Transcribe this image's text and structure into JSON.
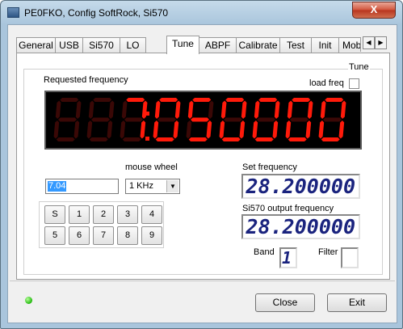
{
  "window": {
    "title": "PE0FKO, Config SoftRock, Si570",
    "close_glyph": "X"
  },
  "tabs": [
    "General",
    "USB",
    "Si570",
    "LO",
    "Tune",
    "ABPF",
    "Calibrate",
    "Test",
    "Init",
    "Mob"
  ],
  "active_tab": "Tune",
  "tab_scroll": {
    "left": "◀",
    "right": "▶"
  },
  "tune": {
    "group_title": "Tune",
    "requested_label": "Requested frequency",
    "load_freq_label": "load freq",
    "load_freq_checked": false,
    "big_display_value": "7.050000",
    "big_display_digits": "7050000",
    "mouse_wheel_label": "mouse wheel",
    "freq_input_value": "7.04",
    "step_value": "1 KHz",
    "keypad": [
      "S",
      "1",
      "2",
      "3",
      "4",
      "5",
      "6",
      "7",
      "8",
      "9"
    ],
    "set_freq_label": "Set frequency",
    "set_freq_value": "28.200000",
    "output_freq_label": "Si570 output frequency",
    "output_freq_value": "28.200000",
    "band_label": "Band",
    "band_value": "1",
    "filter_label": "Filter",
    "filter_value": ""
  },
  "buttons": {
    "close": "Close",
    "exit": "Exit"
  },
  "colors": {
    "segment_on": "#ff1a0a",
    "segment_off": "#3a0806",
    "lcd_text": "#1a237e",
    "status_led": "#22b80e"
  }
}
